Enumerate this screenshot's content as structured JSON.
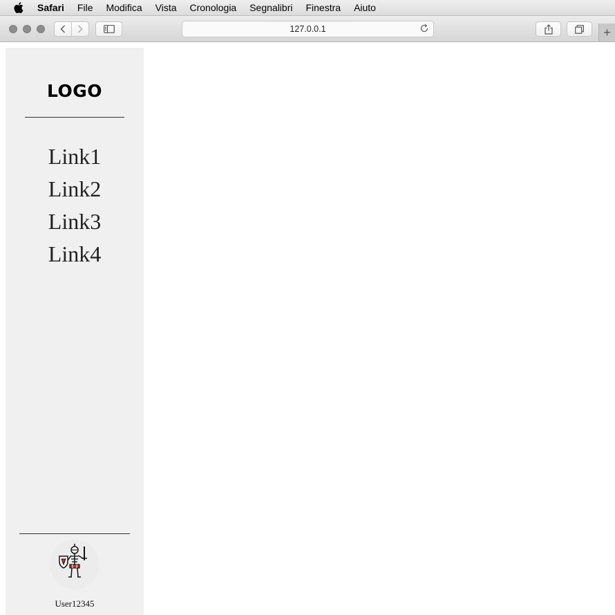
{
  "menubar": {
    "app_name": "Safari",
    "items": [
      "File",
      "Modifica",
      "Vista",
      "Cronologia",
      "Segnalibri",
      "Finestra",
      "Aiuto"
    ]
  },
  "toolbar": {
    "url": "127.0.0.1"
  },
  "sidebar": {
    "logo": "LOGO",
    "links": [
      "Link1",
      "Link2",
      "Link3",
      "Link4"
    ],
    "username": "User12345"
  }
}
